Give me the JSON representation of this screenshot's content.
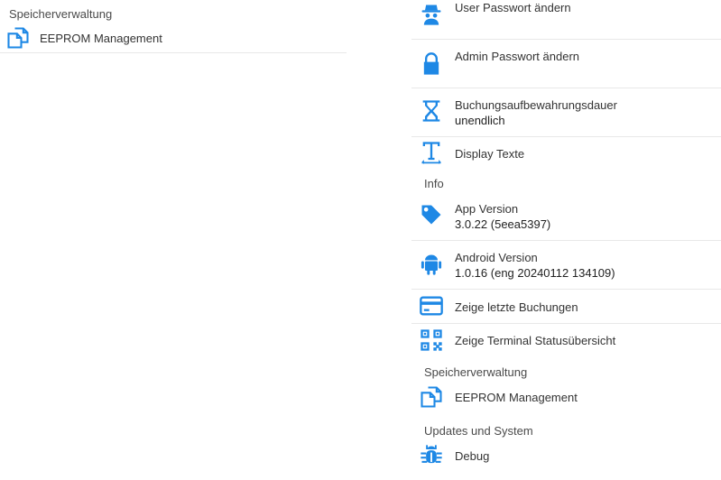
{
  "left_pane": {
    "section_header": "Speicherverwaltung",
    "eeprom_item": {
      "title": "EEPROM Management",
      "icon": "copy-icon"
    }
  },
  "right_pane": {
    "items_top": [
      {
        "title": "User Passwort ändern",
        "icon": "spy-icon"
      },
      {
        "title": "Admin Passwort ändern",
        "icon": "lock-icon"
      },
      {
        "title": "Buchungsaufbewahrungsdauer",
        "subtitle": "unendlich",
        "icon": "hourglass-icon"
      },
      {
        "title": "Display Texte",
        "icon": "text-format-icon"
      }
    ],
    "info_header": "Info",
    "info_items": [
      {
        "title": "App Version",
        "subtitle": "3.0.22 (5eea5397)",
        "icon": "tag-icon"
      },
      {
        "title": "Android Version",
        "subtitle": "1.0.16 (eng 20240112 134109)",
        "icon": "android-icon"
      },
      {
        "title": "Zeige letzte Buchungen",
        "icon": "card-icon"
      },
      {
        "title": "Zeige Terminal Statusübersicht",
        "icon": "qr-code-icon"
      }
    ],
    "storage_header": "Speicherverwaltung",
    "storage_item": {
      "title": "EEPROM Management",
      "icon": "copy-icon"
    },
    "updates_header": "Updates und System",
    "debug_item": {
      "title": "Debug",
      "icon": "bug-icon"
    }
  },
  "colors": {
    "accent": "#1e88e5",
    "divider": "#e8e8e8",
    "text": "#333333"
  }
}
